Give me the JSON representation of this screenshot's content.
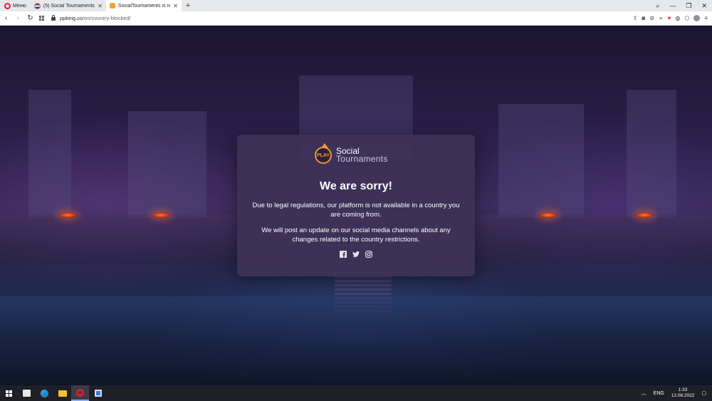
{
  "browser": {
    "menu_label": "Меню",
    "tabs": [
      {
        "label": "(5) Social Tournaments: ту...",
        "active": false
      },
      {
        "label": "SocialTournaments is not a...",
        "active": true
      }
    ],
    "url_host": "ppking.co",
    "url_path": "/en/country-blocked/"
  },
  "dialog": {
    "logo_badge": "PLAY",
    "logo_line1": "Social",
    "logo_line2": "Tournaments",
    "title": "We are sorry!",
    "message1": "Due to legal regulations, our platform is not available in a country you are coming from.",
    "message2": "We will post an update on our social media channels about any changes related to the country restrictions.",
    "socials": [
      "facebook-icon",
      "twitter-icon",
      "instagram-icon"
    ]
  },
  "taskbar": {
    "language": "ENG",
    "time": "1:33",
    "date": "12.08.2022"
  },
  "colors": {
    "accent": "#f29a2e",
    "card": "#3e3258"
  }
}
